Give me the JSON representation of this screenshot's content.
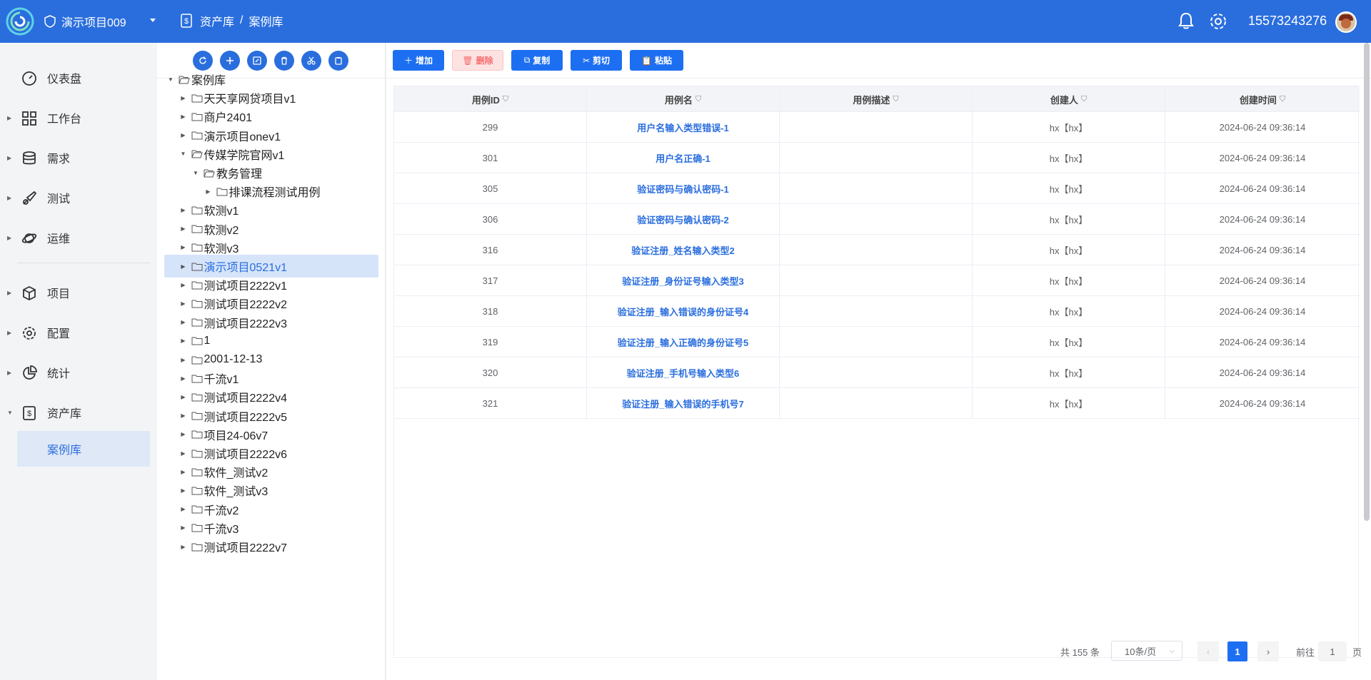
{
  "header": {
    "project_name": "演示项目009",
    "breadcrumb_root": "资产库",
    "breadcrumb_sep": "/",
    "breadcrumb_current": "案例库",
    "user_phone": "15573243276",
    "brand_color": "#2a6ede"
  },
  "sidebar": {
    "items": [
      {
        "label": "仪表盘",
        "icon": "dashboard-icon"
      },
      {
        "label": "工作台",
        "icon": "grid-icon"
      },
      {
        "label": "需求",
        "icon": "database-icon"
      },
      {
        "label": "测试",
        "icon": "brush-icon"
      },
      {
        "label": "运维",
        "icon": "planet-icon"
      },
      {
        "label": "项目",
        "icon": "box-icon"
      },
      {
        "label": "配置",
        "icon": "gear-icon"
      },
      {
        "label": "统计",
        "icon": "pie-icon"
      },
      {
        "label": "资产库",
        "icon": "asset-icon"
      }
    ],
    "sub_active": "案例库"
  },
  "tree": {
    "root": "案例库",
    "nodes": [
      {
        "label": "天天享网贷项目v1",
        "level": 1,
        "open": false
      },
      {
        "label": "商户2401",
        "level": 1,
        "open": false
      },
      {
        "label": "演示项目onev1",
        "level": 1,
        "open": false
      },
      {
        "label": "传媒学院官网v1",
        "level": 1,
        "open": true
      },
      {
        "label": "教务管理",
        "level": 2,
        "open": true
      },
      {
        "label": "排课流程测试用例",
        "level": 3,
        "open": false
      },
      {
        "label": "软测v1",
        "level": 1,
        "open": false
      },
      {
        "label": "软测v2",
        "level": 1,
        "open": false
      },
      {
        "label": "软测v3",
        "level": 1,
        "open": false
      },
      {
        "label": "演示项目0521v1",
        "level": 1,
        "open": false,
        "selected": true
      },
      {
        "label": "测试项目2222v1",
        "level": 1,
        "open": false
      },
      {
        "label": "测试项目2222v2",
        "level": 1,
        "open": false
      },
      {
        "label": "测试项目2222v3",
        "level": 1,
        "open": false
      },
      {
        "label": "1",
        "level": 1,
        "open": false
      },
      {
        "label": "2001-12-13",
        "level": 1,
        "open": false
      },
      {
        "label": "千流v1",
        "level": 1,
        "open": false
      },
      {
        "label": "测试项目2222v4",
        "level": 1,
        "open": false
      },
      {
        "label": "测试项目2222v5",
        "level": 1,
        "open": false
      },
      {
        "label": "项目24-06v7",
        "level": 1,
        "open": false
      },
      {
        "label": "测试项目2222v6",
        "level": 1,
        "open": false
      },
      {
        "label": "软件_测试v2",
        "level": 1,
        "open": false
      },
      {
        "label": "软件_测试v3",
        "level": 1,
        "open": false
      },
      {
        "label": "千流v2",
        "level": 1,
        "open": false
      },
      {
        "label": "千流v3",
        "level": 1,
        "open": false
      },
      {
        "label": "测试项目2222v7",
        "level": 1,
        "open": false
      }
    ]
  },
  "toolbar": {
    "add": "增加",
    "delete": "删除",
    "copy": "复制",
    "cut": "剪切",
    "paste": "粘贴"
  },
  "table": {
    "columns": [
      "用例ID",
      "用例名",
      "用例描述",
      "创建人",
      "创建时间"
    ],
    "rows": [
      {
        "id": "299",
        "name": "用户名输入类型错误-1",
        "desc": "",
        "creator": "hx【hx】",
        "time": "2024-06-24 09:36:14"
      },
      {
        "id": "301",
        "name": "用户名正确-1",
        "desc": "",
        "creator": "hx【hx】",
        "time": "2024-06-24 09:36:14"
      },
      {
        "id": "305",
        "name": "验证密码与确认密码-1",
        "desc": "",
        "creator": "hx【hx】",
        "time": "2024-06-24 09:36:14"
      },
      {
        "id": "306",
        "name": "验证密码与确认密码-2",
        "desc": "",
        "creator": "hx【hx】",
        "time": "2024-06-24 09:36:14"
      },
      {
        "id": "316",
        "name": "验证注册_姓名输入类型2",
        "desc": "",
        "creator": "hx【hx】",
        "time": "2024-06-24 09:36:14"
      },
      {
        "id": "317",
        "name": "验证注册_身份证号输入类型3",
        "desc": "",
        "creator": "hx【hx】",
        "time": "2024-06-24 09:36:14"
      },
      {
        "id": "318",
        "name": "验证注册_输入错误的身份证号4",
        "desc": "",
        "creator": "hx【hx】",
        "time": "2024-06-24 09:36:14"
      },
      {
        "id": "319",
        "name": "验证注册_输入正确的身份证号5",
        "desc": "",
        "creator": "hx【hx】",
        "time": "2024-06-24 09:36:14"
      },
      {
        "id": "320",
        "name": "验证注册_手机号输入类型6",
        "desc": "",
        "creator": "hx【hx】",
        "time": "2024-06-24 09:36:14"
      },
      {
        "id": "321",
        "name": "验证注册_输入错误的手机号7",
        "desc": "",
        "creator": "hx【hx】",
        "time": "2024-06-24 09:36:14"
      }
    ]
  },
  "pagination": {
    "total": "共 155 条",
    "page_size": "10条/页",
    "current_page": "1",
    "goto_label": "前往",
    "goto_value": "1",
    "page_unit": "页"
  }
}
